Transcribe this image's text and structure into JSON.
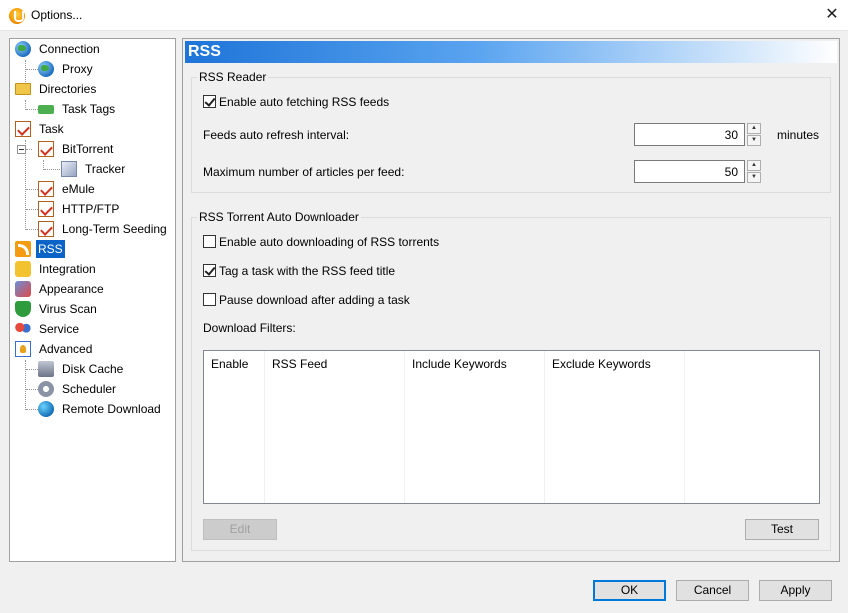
{
  "window": {
    "title": "Options...",
    "close_glyph": "✕"
  },
  "tree": {
    "items": [
      {
        "label": "Connection",
        "icon": "globe-icon"
      },
      {
        "label": "Proxy",
        "icon": "network-icon"
      },
      {
        "label": "Directories",
        "icon": "folder-icon"
      },
      {
        "label": "Task Tags",
        "icon": "tag-icon"
      },
      {
        "label": "Task",
        "icon": "task-icon"
      },
      {
        "label": "BitTorrent",
        "icon": "task-icon"
      },
      {
        "label": "Tracker",
        "icon": "box-icon"
      },
      {
        "label": "eMule",
        "icon": "task-icon"
      },
      {
        "label": "HTTP/FTP",
        "icon": "task-icon"
      },
      {
        "label": "Long-Term Seeding",
        "icon": "task-icon"
      },
      {
        "label": "RSS",
        "icon": "rss-icon"
      },
      {
        "label": "Integration",
        "icon": "puzzle-icon"
      },
      {
        "label": "Appearance",
        "icon": "paint-icon"
      },
      {
        "label": "Virus Scan",
        "icon": "shield-icon"
      },
      {
        "label": "Service",
        "icon": "people-icon"
      },
      {
        "label": "Advanced",
        "icon": "advanced-icon"
      },
      {
        "label": "Disk Cache",
        "icon": "disk-icon"
      },
      {
        "label": "Scheduler",
        "icon": "gear-icon"
      },
      {
        "label": "Remote Download",
        "icon": "earth-icon"
      }
    ],
    "selected": "RSS"
  },
  "header": {
    "title": "RSS"
  },
  "rss_reader": {
    "title": "RSS Reader",
    "enable_fetch_label": "Enable auto fetching RSS feeds",
    "enable_fetch_checked": true,
    "interval_label": "Feeds auto refresh interval:",
    "interval_value": "30",
    "interval_unit": "minutes",
    "max_articles_label": "Maximum number of articles per feed:",
    "max_articles_value": "50"
  },
  "auto_downloader": {
    "title": "RSS Torrent Auto Downloader",
    "enable_download_label": "Enable auto downloading of RSS torrents",
    "enable_download_checked": false,
    "tag_task_label": "Tag a task with the RSS feed title",
    "tag_task_checked": true,
    "pause_label": "Pause download after adding a task",
    "pause_checked": false,
    "filters_label": "Download Filters:",
    "columns": [
      "Enable",
      "RSS Feed",
      "Include Keywords",
      "Exclude Keywords"
    ],
    "edit_label": "Edit",
    "test_label": "Test"
  },
  "footer": {
    "ok_label": "OK",
    "cancel_label": "Cancel",
    "apply_label": "Apply"
  },
  "colors": {
    "accent": "#0a64c8",
    "header_start": "#1e74d8"
  }
}
